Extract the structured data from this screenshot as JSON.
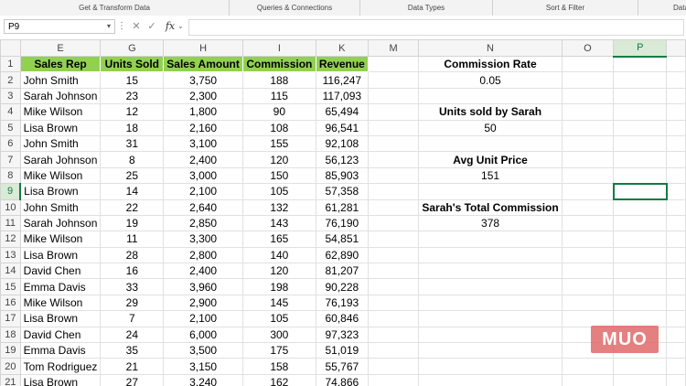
{
  "ribbon": {
    "groups": [
      "Get & Transform Data",
      "Queries & Connections",
      "Data Types",
      "Sort & Filter",
      "Data"
    ]
  },
  "formula_bar": {
    "name_box": "P9",
    "function_icon": "fx",
    "formula": ""
  },
  "sheet": {
    "column_headers": [
      "E",
      "G",
      "H",
      "I",
      "K",
      "M",
      "N",
      "O",
      "P"
    ],
    "selected_cell": "P9",
    "headers": [
      "Sales Rep",
      "Units Sold",
      "Sales Amount",
      "Commission",
      "Revenue"
    ],
    "rows": [
      {
        "num": "2",
        "rep": "John Smith",
        "units": "15",
        "amount": "3,750",
        "comm": "188",
        "rev": "116,247"
      },
      {
        "num": "3",
        "rep": "Sarah Johnson",
        "units": "23",
        "amount": "2,300",
        "comm": "115",
        "rev": "117,093"
      },
      {
        "num": "4",
        "rep": "Mike Wilson",
        "units": "12",
        "amount": "1,800",
        "comm": "90",
        "rev": "65,494"
      },
      {
        "num": "5",
        "rep": "Lisa Brown",
        "units": "18",
        "amount": "2,160",
        "comm": "108",
        "rev": "96,541"
      },
      {
        "num": "6",
        "rep": "John Smith",
        "units": "31",
        "amount": "3,100",
        "comm": "155",
        "rev": "92,108"
      },
      {
        "num": "7",
        "rep": "Sarah Johnson",
        "units": "8",
        "amount": "2,400",
        "comm": "120",
        "rev": "56,123"
      },
      {
        "num": "8",
        "rep": "Mike Wilson",
        "units": "25",
        "amount": "3,000",
        "comm": "150",
        "rev": "85,903"
      },
      {
        "num": "9",
        "rep": "Lisa Brown",
        "units": "14",
        "amount": "2,100",
        "comm": "105",
        "rev": "57,358"
      },
      {
        "num": "10",
        "rep": "John Smith",
        "units": "22",
        "amount": "2,640",
        "comm": "132",
        "rev": "61,281"
      },
      {
        "num": "11",
        "rep": "Sarah Johnson",
        "units": "19",
        "amount": "2,850",
        "comm": "143",
        "rev": "76,190"
      },
      {
        "num": "12",
        "rep": "Mike Wilson",
        "units": "11",
        "amount": "3,300",
        "comm": "165",
        "rev": "54,851"
      },
      {
        "num": "13",
        "rep": "Lisa Brown",
        "units": "28",
        "amount": "2,800",
        "comm": "140",
        "rev": "62,890"
      },
      {
        "num": "14",
        "rep": "David Chen",
        "units": "16",
        "amount": "2,400",
        "comm": "120",
        "rev": "81,207"
      },
      {
        "num": "15",
        "rep": "Emma Davis",
        "units": "33",
        "amount": "3,960",
        "comm": "198",
        "rev": "90,228"
      },
      {
        "num": "16",
        "rep": "Mike Wilson",
        "units": "29",
        "amount": "2,900",
        "comm": "145",
        "rev": "76,193"
      },
      {
        "num": "17",
        "rep": "Lisa Brown",
        "units": "7",
        "amount": "2,100",
        "comm": "105",
        "rev": "60,846"
      },
      {
        "num": "18",
        "rep": "David Chen",
        "units": "24",
        "amount": "6,000",
        "comm": "300",
        "rev": "97,323"
      },
      {
        "num": "19",
        "rep": "Emma Davis",
        "units": "35",
        "amount": "3,500",
        "comm": "175",
        "rev": "51,019"
      },
      {
        "num": "20",
        "rep": "Tom Rodriguez",
        "units": "21",
        "amount": "3,150",
        "comm": "158",
        "rev": "55,767"
      },
      {
        "num": "21",
        "rep": "Lisa Brown",
        "units": "27",
        "amount": "3,240",
        "comm": "162",
        "rev": "74,866"
      }
    ],
    "info": {
      "commission_rate_label": "Commission Rate",
      "commission_rate_value": "0.05",
      "units_sarah_label": "Units sold by Sarah",
      "units_sarah_value": "50",
      "avg_price_label": "Avg Unit Price",
      "avg_price_value": "151",
      "sarah_commission_label": "Sarah's Total Commission",
      "sarah_commission_value": "378"
    }
  },
  "watermark": {
    "text": "MUO"
  },
  "colors": {
    "header_fill": "#92d050",
    "accent": "#107c41",
    "logo": "#e06a6a"
  }
}
